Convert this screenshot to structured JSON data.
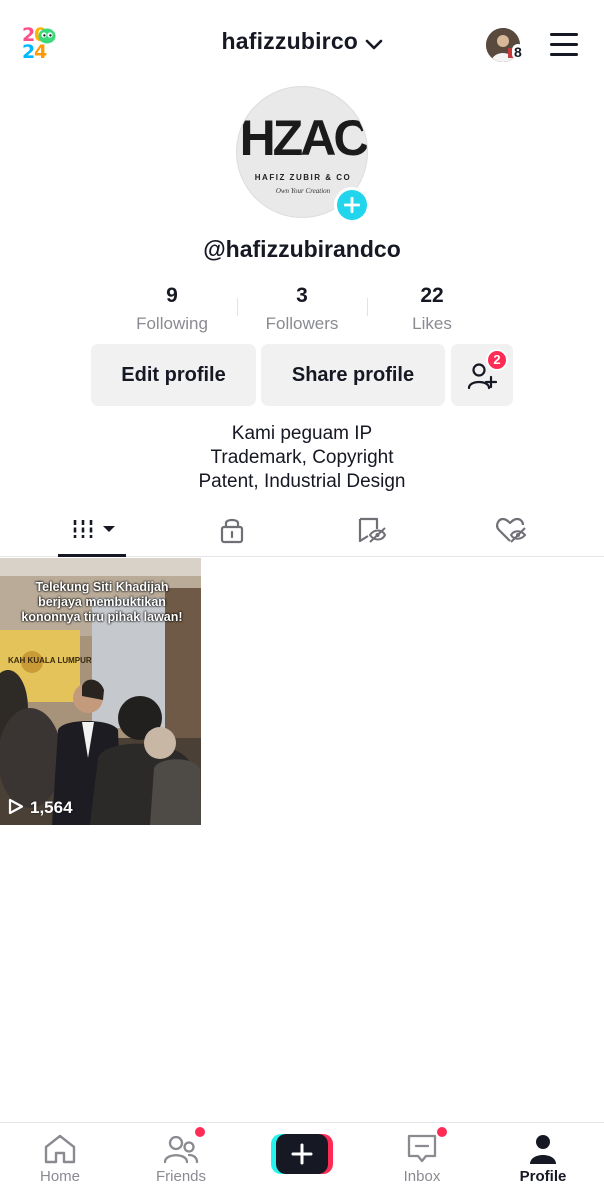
{
  "header": {
    "year_logo": [
      "2",
      "0",
      "2",
      "4"
    ],
    "username": "hafizzubirco",
    "friends_count": "8",
    "menu_icon": "hamburger-menu-icon"
  },
  "profile": {
    "avatar_text": "HZAC",
    "avatar_subtext": "HAFIZ ZUBIR & CO",
    "avatar_tagline": "Own Your Creation",
    "handle": "@hafizzubirandco",
    "stats": [
      {
        "value": "9",
        "label": "Following"
      },
      {
        "value": "3",
        "label": "Followers"
      },
      {
        "value": "22",
        "label": "Likes"
      }
    ],
    "buttons": {
      "edit": "Edit profile",
      "share": "Share profile",
      "add_friends_badge": "2"
    },
    "bio": [
      "Kami peguam IP",
      "Trademark, Copyright",
      "Patent, Industrial Design"
    ]
  },
  "tabs": [
    {
      "icon": "videos-grid-icon",
      "active": true
    },
    {
      "icon": "private-lock-icon",
      "active": false
    },
    {
      "icon": "favorites-icon",
      "active": false
    },
    {
      "icon": "liked-hidden-icon",
      "active": false
    }
  ],
  "videos": [
    {
      "caption": [
        "Telekung Siti Khadijah",
        "berjaya membuktikan",
        "kononnya tiru pihak lawan!"
      ],
      "sign_text": "KAH KUALA LUMPUR",
      "views": "1,564"
    }
  ],
  "bottom_nav": [
    {
      "label": "Home",
      "icon": "home-icon",
      "active": false,
      "dot": false
    },
    {
      "label": "Friends",
      "icon": "friends-icon",
      "active": false,
      "dot": true
    },
    {
      "label": "",
      "icon": "create-plus-icon",
      "active": false,
      "dot": false
    },
    {
      "label": "Inbox",
      "icon": "inbox-icon",
      "active": false,
      "dot": true
    },
    {
      "label": "Profile",
      "icon": "profile-icon",
      "active": true,
      "dot": false
    }
  ],
  "colors": {
    "accent_red": "#fe2c55",
    "accent_cyan": "#25f4ee",
    "add_badge": "#20d5ec",
    "text_primary": "#161823",
    "text_secondary": "#8a8b91",
    "button_bg": "#f1f1f2"
  }
}
